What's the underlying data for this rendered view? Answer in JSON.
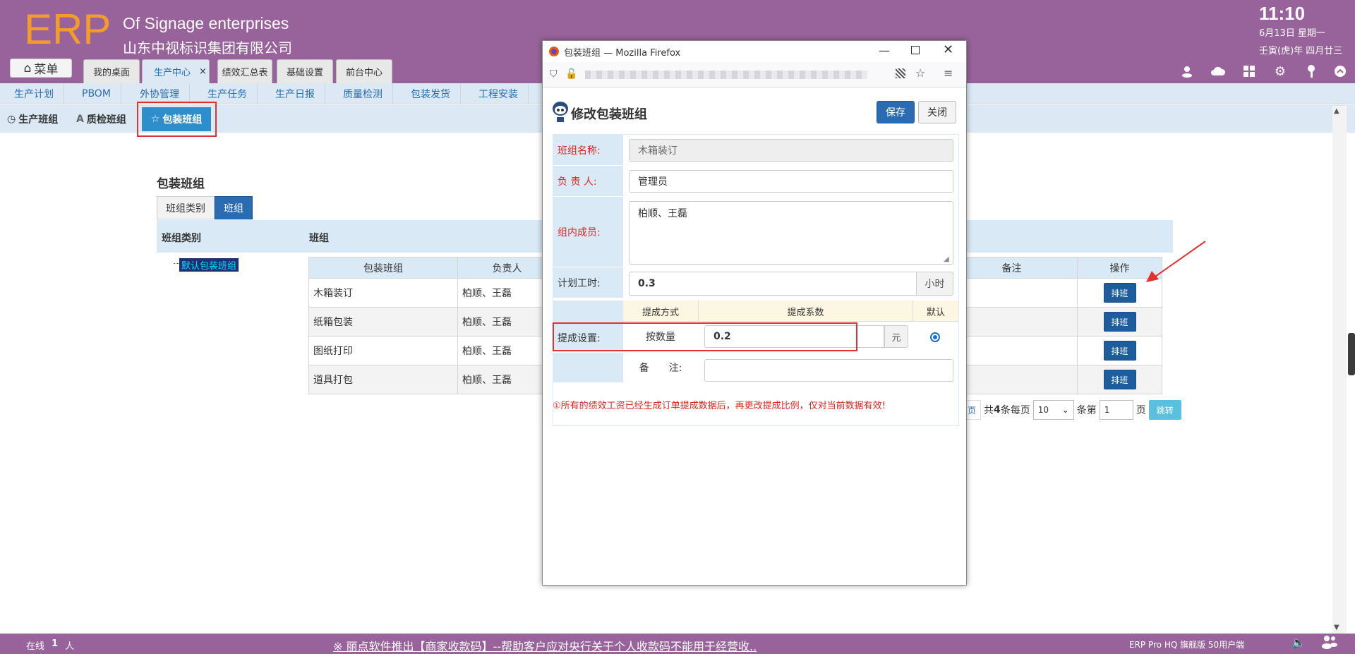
{
  "header": {
    "logo": "ERP",
    "company_en": "Of Signage enterprises",
    "company_cn": "山东中视标识集团有限公司",
    "menu_label": "菜单",
    "tabs": [
      {
        "label": "我的桌面"
      },
      {
        "label": "生产中心",
        "active": true
      },
      {
        "label": "绩效汇总表"
      },
      {
        "label": "基础设置"
      },
      {
        "label": "前台中心"
      }
    ],
    "tab_close": "×",
    "clock": {
      "time": "11:10",
      "date": "6月13日 星期一",
      "lunar": "壬寅(虎)年 四月廿三"
    },
    "icons": [
      "user-icon",
      "cloud-icon",
      "apps-icon",
      "gear-icon",
      "key-icon",
      "collapse-icon"
    ]
  },
  "nav": {
    "items": [
      "生产计划",
      "PBOM",
      "外协管理",
      "生产任务",
      "生产日报",
      "质量检测",
      "包装发货",
      "工程安装"
    ]
  },
  "subtabs": [
    {
      "label": "生产班组",
      "icon": "clock-icon"
    },
    {
      "label": "质检班组",
      "icon": "font-a-icon"
    },
    {
      "label": "包装班组",
      "icon": "star-icon",
      "active": true
    }
  ],
  "main": {
    "title": "包装班组",
    "segments": [
      "班组类别",
      "班组"
    ],
    "col_category": "班组类别",
    "col_group": "班组",
    "tree_item": "默认包装班组",
    "grid_headers": [
      "包装班组",
      "负责人",
      "备注",
      "操作"
    ],
    "rows": [
      {
        "name": "木箱装订",
        "leader": "柏顺、王磊",
        "note": "",
        "action": "排班"
      },
      {
        "name": "纸箱包装",
        "leader": "柏顺、王磊",
        "note": "",
        "action": "排班"
      },
      {
        "name": "图纸打印",
        "leader": "柏顺、王磊",
        "note": "",
        "action": "排班"
      },
      {
        "name": "道具打包",
        "leader": "柏顺、王磊",
        "note": "",
        "action": "排班"
      }
    ],
    "pager": {
      "partial_label": "页",
      "total_prefix": "共",
      "total": "4",
      "total_suffix": "条每页",
      "page_size": "10",
      "goto_prefix": "条第",
      "page_input": "1",
      "goto_suffix": "页",
      "jump": "跳转"
    }
  },
  "footer": {
    "online_prefix": "在线",
    "online_count": "1",
    "online_suffix": "人",
    "marquee": "※ 丽点软件推出【商家收款码】--帮助客户应对央行关于个人收款码不能用于经营收..",
    "version": "ERP Pro HQ 旗舰版 50用户端"
  },
  "popup": {
    "window_title": "包装班组 — Mozilla Firefox",
    "heading": "修改包装班组",
    "save": "保存",
    "close": "关闭",
    "fields": {
      "group_name_label": "班组名称:",
      "group_name_value": "木箱装订",
      "leader_label": "负 责 人:",
      "leader_value": "管理员",
      "members_label": "组内成员:",
      "members_value": "柏顺、王磊",
      "hours_label": "计划工时:",
      "hours_value": "0.3",
      "hours_unit": "小时",
      "commission_col_method": "提成方式",
      "commission_col_coef": "提成系数",
      "commission_col_default": "默认",
      "commission_label": "提成设置:",
      "commission_method": "按数量",
      "commission_value": "0.2",
      "commission_unit": "元",
      "note_label": "备　　注:",
      "note_value": ""
    },
    "warning": "①所有的绩效工资已经生成订单提成数据后，再更改提成比例，仅对当前数据有效!"
  },
  "colors": {
    "header": "#98639b",
    "accent": "#2e8dcb",
    "highlight": "#e53030",
    "logo": "#f39c2b"
  }
}
